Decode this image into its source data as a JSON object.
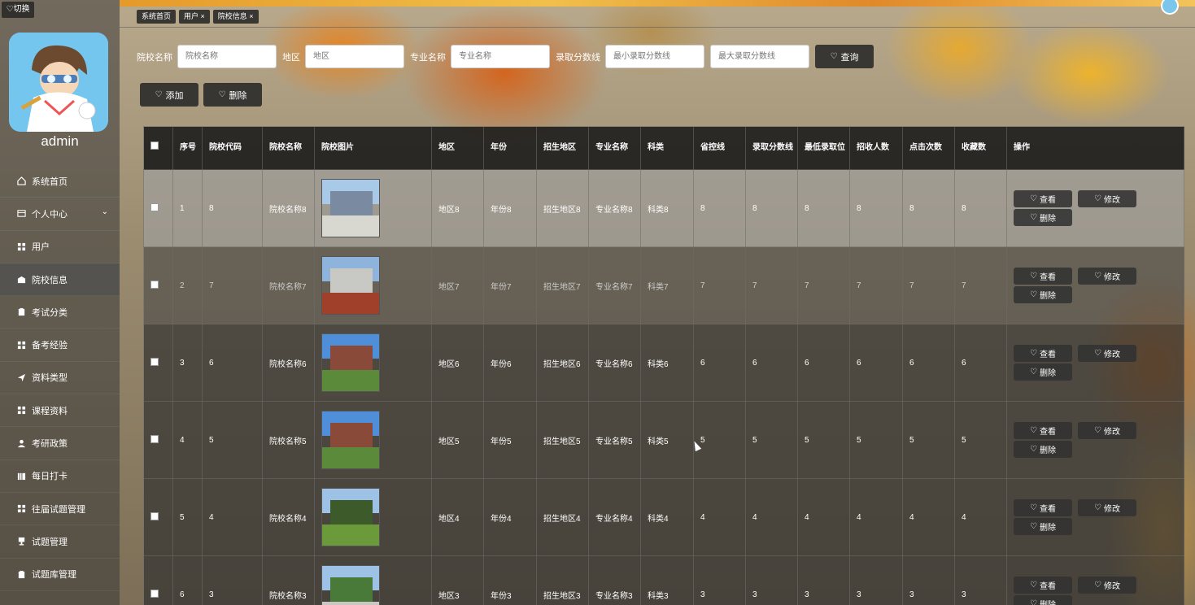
{
  "sidebar": {
    "switch_label": "♡切换",
    "username": "admin",
    "items": [
      {
        "label": "系统首页",
        "icon": "home-icon",
        "active": false
      },
      {
        "label": "个人中心",
        "icon": "profile-icon",
        "active": false,
        "expandable": true
      },
      {
        "label": "用户",
        "icon": "grid-icon",
        "active": false
      },
      {
        "label": "院校信息",
        "icon": "school-icon",
        "active": true
      },
      {
        "label": "考试分类",
        "icon": "clipboard-icon",
        "active": false
      },
      {
        "label": "备考经验",
        "icon": "grid-icon",
        "active": false
      },
      {
        "label": "资料类型",
        "icon": "send-icon",
        "active": false
      },
      {
        "label": "课程资料",
        "icon": "grid-icon",
        "active": false
      },
      {
        "label": "考研政策",
        "icon": "person-icon",
        "active": false
      },
      {
        "label": "每日打卡",
        "icon": "bars-icon",
        "active": false
      },
      {
        "label": "往届试题管理",
        "icon": "grid-icon",
        "active": false
      },
      {
        "label": "试题管理",
        "icon": "cup-icon",
        "active": false
      },
      {
        "label": "试题库管理",
        "icon": "clipboard-icon",
        "active": false
      }
    ]
  },
  "tabs": [
    "系统首页",
    "用户 ×",
    "院校信息 ×"
  ],
  "search": {
    "school_label": "院校名称",
    "school_placeholder": "院校名称",
    "region_label": "地区",
    "region_placeholder": "地区",
    "major_label": "专业名称",
    "major_placeholder": "专业名称",
    "score_label": "录取分数线",
    "min_placeholder": "最小录取分数线",
    "max_placeholder": "最大录取分数线",
    "query_button": "查询"
  },
  "actions": {
    "add": "添加",
    "delete": "删除"
  },
  "table": {
    "headers": [
      "序号",
      "院校代码",
      "院校名称",
      "院校图片",
      "地区",
      "年份",
      "招生地区",
      "专业名称",
      "科类",
      "省控线",
      "录取分数线",
      "最低录取位",
      "招收人数",
      "点击次数",
      "收藏数",
      "操作"
    ],
    "op_view": "查看",
    "op_edit": "修改",
    "op_delete": "删除",
    "rows": [
      {
        "idx": "1",
        "code": "8",
        "name": "院校名称8",
        "region": "地区8",
        "year": "年份8",
        "enroll_region": "招生地区8",
        "major": "专业名称8",
        "category": "科类8",
        "control": "8",
        "score": "8",
        "rank": "8",
        "count": "8",
        "clicks": "8",
        "favs": "8"
      },
      {
        "idx": "2",
        "code": "7",
        "name": "院校名称7",
        "region": "地区7",
        "year": "年份7",
        "enroll_region": "招生地区7",
        "major": "专业名称7",
        "category": "科类7",
        "control": "7",
        "score": "7",
        "rank": "7",
        "count": "7",
        "clicks": "7",
        "favs": "7"
      },
      {
        "idx": "3",
        "code": "6",
        "name": "院校名称6",
        "region": "地区6",
        "year": "年份6",
        "enroll_region": "招生地区6",
        "major": "专业名称6",
        "category": "科类6",
        "control": "6",
        "score": "6",
        "rank": "6",
        "count": "6",
        "clicks": "6",
        "favs": "6"
      },
      {
        "idx": "4",
        "code": "5",
        "name": "院校名称5",
        "region": "地区5",
        "year": "年份5",
        "enroll_region": "招生地区5",
        "major": "专业名称5",
        "category": "科类5",
        "control": "5",
        "score": "5",
        "rank": "5",
        "count": "5",
        "clicks": "5",
        "favs": "5"
      },
      {
        "idx": "5",
        "code": "4",
        "name": "院校名称4",
        "region": "地区4",
        "year": "年份4",
        "enroll_region": "招生地区4",
        "major": "专业名称4",
        "category": "科类4",
        "control": "4",
        "score": "4",
        "rank": "4",
        "count": "4",
        "clicks": "4",
        "favs": "4"
      },
      {
        "idx": "6",
        "code": "3",
        "name": "院校名称3",
        "region": "地区3",
        "year": "年份3",
        "enroll_region": "招生地区3",
        "major": "专业名称3",
        "category": "科类3",
        "control": "3",
        "score": "3",
        "rank": "3",
        "count": "3",
        "clicks": "3",
        "favs": "3"
      }
    ]
  }
}
